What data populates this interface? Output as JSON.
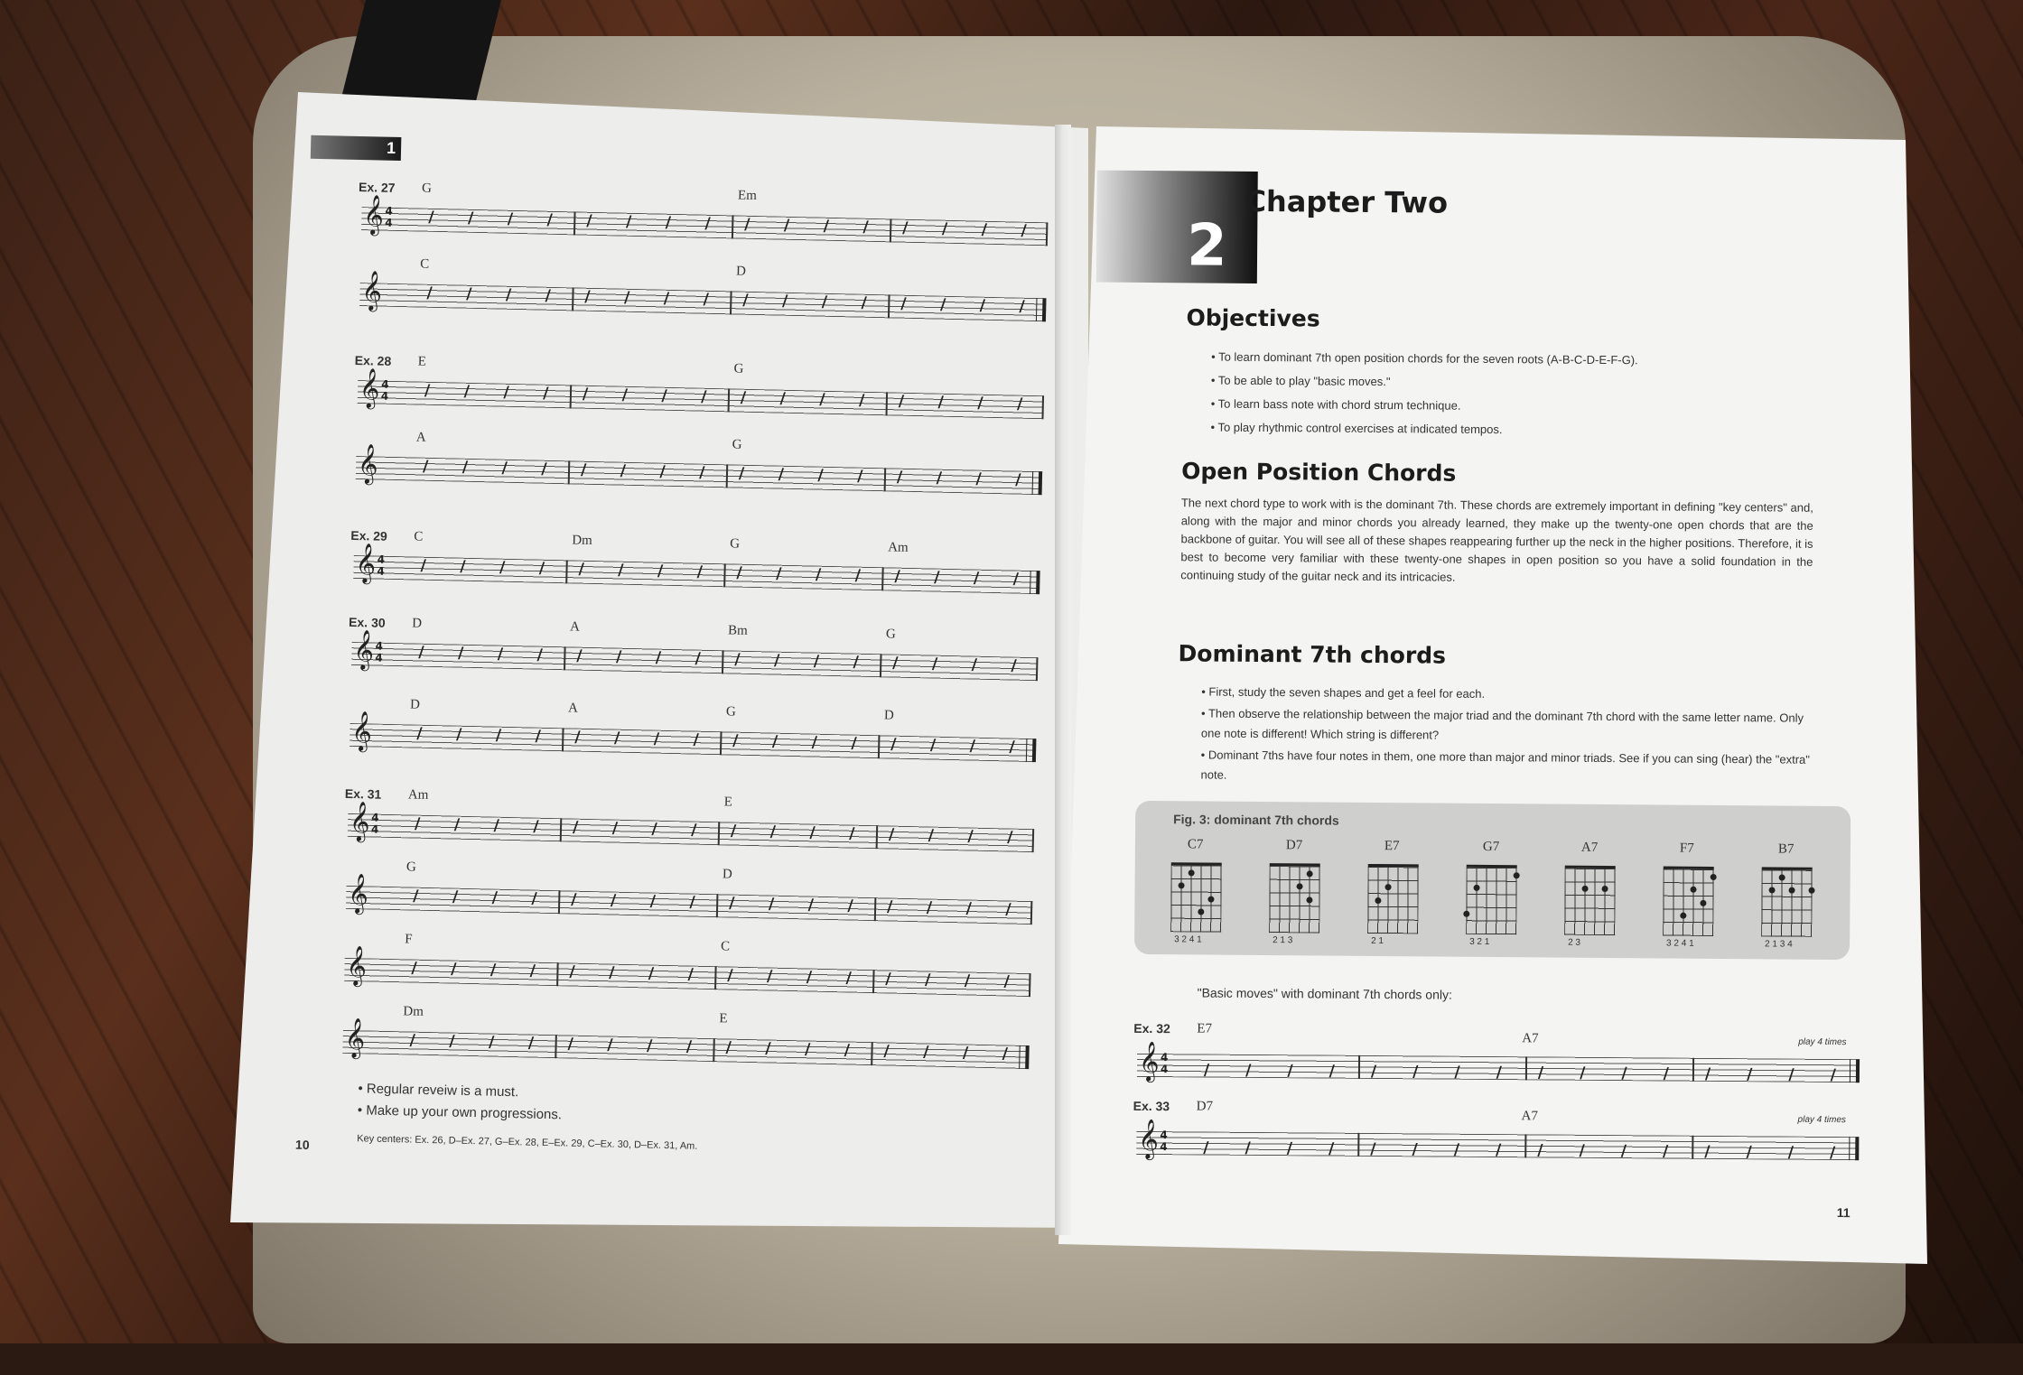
{
  "left_page": {
    "chapter_tab": "1",
    "page_number": "10",
    "examples": [
      {
        "label": "Ex. 27",
        "lines": [
          [
            "G",
            "Em"
          ],
          [
            "C",
            "D"
          ]
        ]
      },
      {
        "label": "Ex. 28",
        "lines": [
          [
            "E",
            "G"
          ],
          [
            "A",
            "G"
          ]
        ]
      },
      {
        "label": "Ex. 29",
        "lines": [
          [
            "C",
            "Dm",
            "G",
            "Am"
          ]
        ]
      },
      {
        "label": "Ex. 30",
        "lines": [
          [
            "D",
            "A",
            "Bm",
            "G"
          ],
          [
            "D",
            "A",
            "G",
            "D"
          ]
        ]
      },
      {
        "label": "Ex. 31",
        "lines": [
          [
            "Am",
            "E"
          ],
          [
            "G",
            "D"
          ],
          [
            "F",
            "C"
          ],
          [
            "Dm",
            "E"
          ]
        ]
      }
    ],
    "notes": [
      "Regular reveiw is a must.",
      "Make up your own progressions."
    ],
    "key_centers": "Key centers: Ex. 26, D–Ex. 27, G–Ex. 28, E–Ex. 29, C–Ex. 30, D–Ex. 31, Am."
  },
  "right_page": {
    "chapter_number": "2",
    "chapter_title": "Chapter Two",
    "objectives_heading": "Objectives",
    "objectives": [
      "To learn dominant 7th open position chords for the seven roots (A-B-C-D-E-F-G).",
      "To be able to play \"basic moves.\"",
      "To learn bass note with chord strum technique.",
      "To play rhythmic control exercises at indicated tempos."
    ],
    "open_heading": "Open Position Chords",
    "open_paragraph": "The next chord type to work with is the dominant 7th. These chords are extremely important in defining \"key centers\" and, along with the major and minor chords you already learned, they make up the twenty-one open chords that are the backbone of guitar. You will see all of these shapes reappearing further up the neck in the higher positions. Therefore, it is best to become very familiar with these twenty-one shapes in open position so you have a solid foundation in the continuing study of the guitar neck and its intricacies.",
    "dom_heading": "Dominant 7th chords",
    "dom_bullets": [
      "First, study the seven shapes and get a feel for each.",
      "Then observe the relationship between the major triad and the dominant 7th chord with the same letter name. Only one note is different! Which string is different?",
      "Dominant 7ths have four notes in them, one more than major and minor triads. See if  you can sing (hear) the \"extra\" note."
    ],
    "fig_title": "Fig. 3: dominant 7th chords",
    "chords": [
      {
        "name": "C7",
        "fingers": "3 2 4 1"
      },
      {
        "name": "D7",
        "fingers": "2 1 3"
      },
      {
        "name": "E7",
        "fingers": "2    1"
      },
      {
        "name": "G7",
        "fingers": "3 2         1"
      },
      {
        "name": "A7",
        "fingers": "2   3"
      },
      {
        "name": "F7",
        "fingers": "3 2 4 1"
      },
      {
        "name": "B7",
        "fingers": "2 1 3   4"
      }
    ],
    "basic_moves": "\"Basic moves\" with dominant 7th chords only:",
    "ex32": {
      "label": "Ex. 32",
      "chords": [
        "E7",
        "A7"
      ],
      "repeat": "play 4 times"
    },
    "ex33": {
      "label": "Ex. 33",
      "chords": [
        "D7",
        "A7"
      ],
      "repeat": "play 4 times"
    },
    "page_number": "11"
  }
}
